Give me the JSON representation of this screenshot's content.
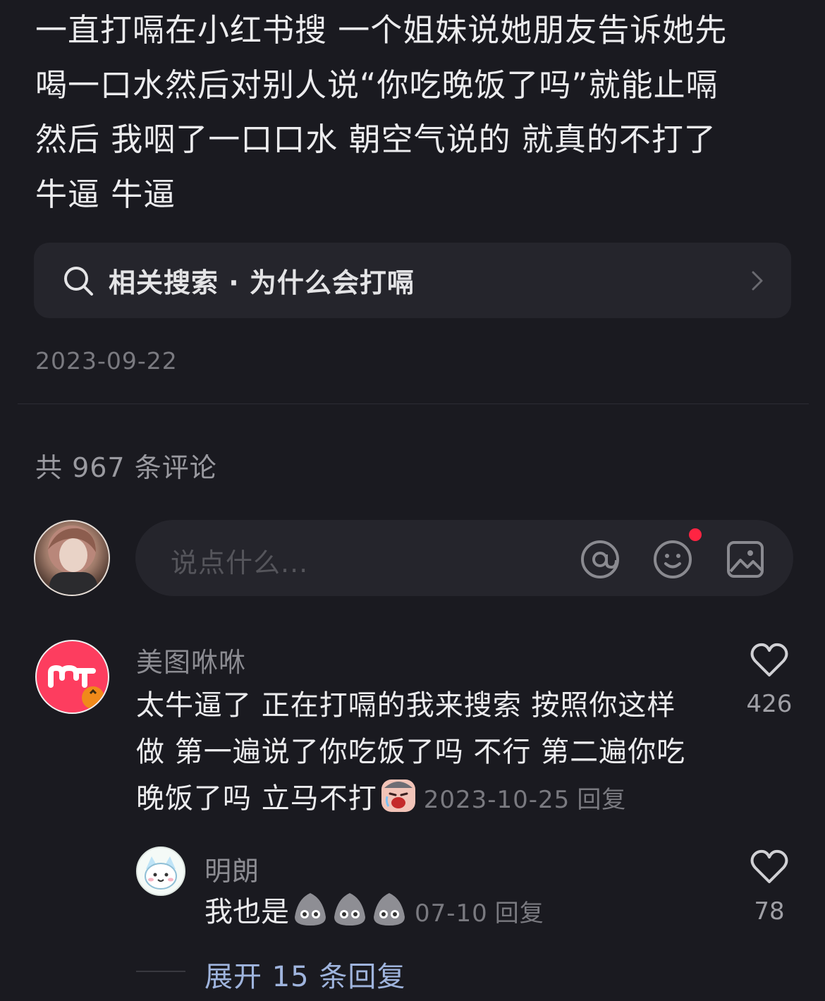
{
  "post": {
    "lines": [
      "一直打嗝在小红书搜 一个姐妹说她朋友告诉她先",
      "喝一口水然后对别人说“你吃晚饭了吗”就能止嗝",
      "然后 我咽了一口口水 朝空气说的 就真的不打了",
      "牛逼 牛逼"
    ],
    "related_search": "相关搜索 · 为什么会打嗝",
    "date": "2023-09-22"
  },
  "comments_header": {
    "count_text": "共 967 条评论"
  },
  "input": {
    "placeholder": "说点什么..."
  },
  "comment": {
    "author": "美图咻咻",
    "lines": [
      "太牛逼了 正在打嗝的我来搜索 按照你这样",
      "做 第一遍说了你吃饭了吗 不行 第二遍你吃",
      "晚饭了吗 立马不打"
    ],
    "date": "2023-10-25",
    "reply_label": "回复",
    "likes": "426"
  },
  "reply": {
    "author": "明朗",
    "text": "我也是",
    "date": "07-10",
    "reply_label": "回复",
    "likes": "78"
  },
  "expand": {
    "label": "展开 15 条回复"
  },
  "colors": {
    "background": "#1a1a20",
    "card": "#25252c",
    "accent_red": "#ff2442",
    "link_blue": "#9fb4dd"
  },
  "icons": [
    "search-icon",
    "chevron-right-icon",
    "at-icon",
    "emoji-icon",
    "image-icon",
    "heart-icon"
  ]
}
